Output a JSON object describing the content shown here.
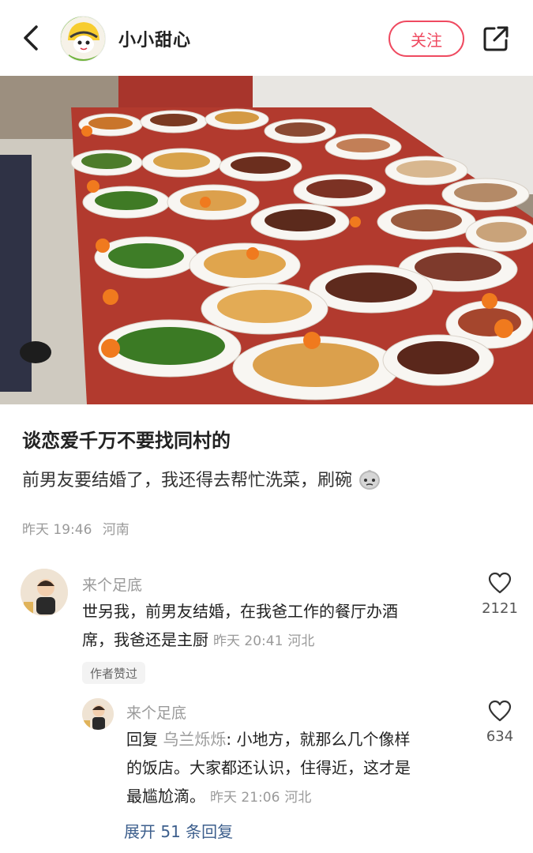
{
  "header": {
    "author_name": "小小甜心",
    "follow_label": "关注"
  },
  "post": {
    "title": "谈恋爱千万不要找同村的",
    "body": "前男友要结婚了，我还得去帮忙洗菜，刷碗",
    "time": "昨天 19:46",
    "location": "河南"
  },
  "comments": [
    {
      "user": "来个足底",
      "text_line1": "世另我，前男友结婚，在我爸工作的餐厅办酒",
      "text_line2": "席，我爸还是主厨",
      "time": "昨天 20:41",
      "location": "河北",
      "likes": "2121",
      "author_liked": "作者赞过",
      "reply": {
        "user": "来个足底",
        "reply_prefix": "回复",
        "reply_to": "乌兰烁烁",
        "text_line1": ": 小地方，就那么几个像样",
        "text_line2": "的饭店。大家都还认识，住得近，这才是",
        "text_line3": "最尴尬滴。",
        "time": "昨天 21:06",
        "location": "河北",
        "likes": "634"
      },
      "expand_label": "展开 51 条回复"
    }
  ],
  "colors": {
    "accent": "#ef4a60",
    "link": "#3d5f8d",
    "muted": "#9a9a9a"
  }
}
